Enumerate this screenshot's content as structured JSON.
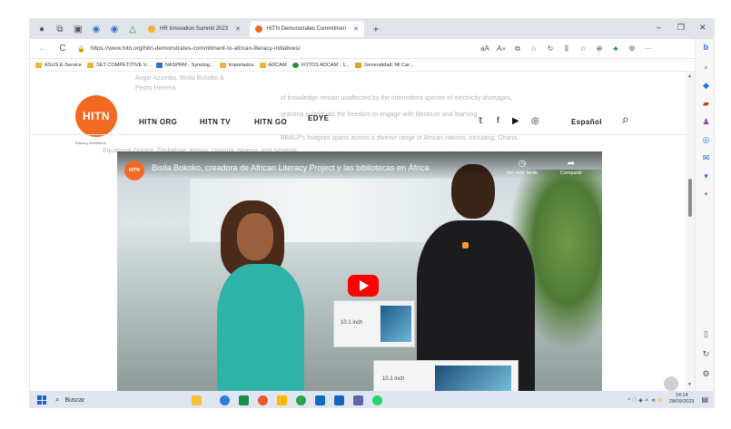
{
  "browser": {
    "tabs": [
      {
        "title": "HR Innovation Summit 2023",
        "active": false
      },
      {
        "title": "HITN Demonstrates Commitmen",
        "active": true
      }
    ],
    "new_tab_glyph": "+",
    "window_controls": {
      "minimize": "–",
      "restore": "❐",
      "close": "✕"
    },
    "url": "https://www.hitn.org/hitn-demonstrates-commitment-to-african-literacy-initiatives/",
    "nav_glyphs": {
      "back": "←",
      "refresh": "C",
      "lock": "🔒"
    },
    "address_icons": [
      "aA",
      "A»",
      "⧉",
      "☆",
      "↻",
      "⫼",
      "☆",
      "⊕",
      "♣",
      "⚙",
      "···"
    ],
    "bookmarks": [
      {
        "label": "ASUS E-Service",
        "color": "#f0b430"
      },
      {
        "label": "SET COMPETITIVE V...",
        "color": "#f0b430"
      },
      {
        "label": "NASPRM - Synolog...",
        "color": "#2f6fd1"
      },
      {
        "label": "Importados",
        "color": "#f0b430"
      },
      {
        "label": "ADCAM",
        "color": "#f0b430"
      },
      {
        "label": "FOTOS ADCAM - 1...",
        "color": "#2a8f3c"
      },
      {
        "label": "Generalidad: Mi Car...",
        "color": "#d9a22b"
      }
    ]
  },
  "page": {
    "faded_text": [
      "Angie Azumbo, Bisila Bokoko &",
      "Pedro Herrera",
      "of knowledge remain unaffected by the intermittent specter of electricity shortages,",
      "granting individuals the freedom to engage with literature and learning.",
      "BBALP's footprint spans across a diverse range of African nations, including: Ghana,",
      "Equatorial Guinea, Zimbabwe, Kenya, Uganda, Nigeria, and Senegal."
    ],
    "logo_text": "HITN",
    "logo_tagline": "Educa y Entretiene",
    "nav": [
      {
        "label": "HITN ORG"
      },
      {
        "label": "HITN TV"
      },
      {
        "label": "HITN GO"
      },
      {
        "label": "EDYE"
      }
    ],
    "social_icons": [
      "𝕥",
      "f",
      "▶",
      "◎"
    ],
    "language_link": "Español",
    "search_icon": "⌕",
    "video": {
      "channel_badge": "HITN",
      "title": "Bisila Bokoko, creadora de African Literacy Project y las bibliotecas en África",
      "watch_later_label": "Ver más tarde",
      "share_label": "Compartir",
      "box_labels": [
        "10.1 inch",
        "10.1 inch"
      ]
    }
  },
  "taskbar": {
    "search_placeholder": "Buscar",
    "icons": [
      "#f3c036",
      "#2d7bd8",
      "#1b8a4a",
      "#e25b29",
      "#ffb900",
      "#2aa14a",
      "#0f6cbd",
      "#1565c0",
      "#6264a7",
      "#25d366"
    ],
    "tray": "^ ☁ ◈ ㅅ ⊲ ⚡",
    "time": "14:14",
    "date": "28/09/2023"
  }
}
